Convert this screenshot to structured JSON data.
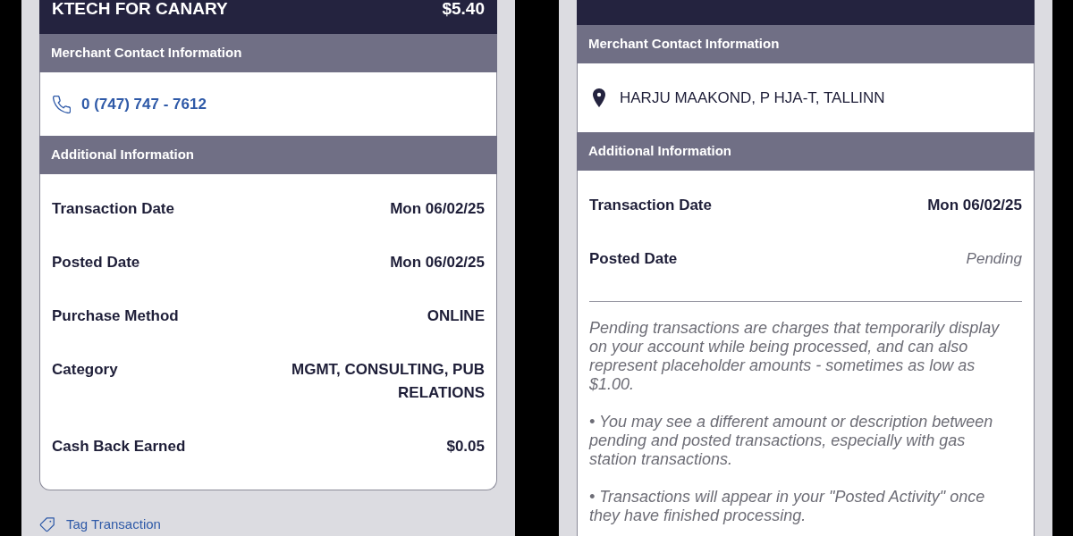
{
  "panels": [
    {
      "header": {
        "merchant": "KTECH FOR CANARY",
        "amount": "$5.40"
      },
      "sections": [
        {
          "title": "Merchant Contact Information",
          "contact": {
            "kind": "phone",
            "text": "0 (747) 747 - 7612"
          }
        },
        {
          "title": "Additional Information",
          "rows": [
            {
              "label": "Transaction Date",
              "value": "Mon 06/02/25"
            },
            {
              "label": "Posted Date",
              "value": "Mon 06/02/25"
            },
            {
              "label": "Purchase Method",
              "value": "ONLINE"
            },
            {
              "label": "Category",
              "value": "MGMT, CONSULTING, PUB RELATIONS"
            },
            {
              "label": "Cash Back Earned",
              "value": "$0.05"
            }
          ]
        }
      ],
      "tag_link": "Tag Transaction"
    },
    {
      "sections": [
        {
          "title": "Merchant Contact Information",
          "contact": {
            "kind": "address",
            "text": "HARJU MAAKOND, P HJA-T, TALLINN"
          }
        },
        {
          "title": "Additional Information",
          "rows": [
            {
              "label": "Transaction Date",
              "value": "Mon 06/02/25",
              "kind": "plain"
            },
            {
              "label": "Posted Date",
              "value": "Pending",
              "kind": "pending"
            }
          ],
          "notes": [
            "Pending transactions are charges that temporarily display on your account while being processed, and can also represent placeholder amounts - sometimes as low as $1.00.",
            "• You may see a different amount or description between pending and posted transactions, especially with gas station transactions.",
            "• Transactions will appear in your \"Posted Activity\" once they have finished processing."
          ]
        }
      ]
    }
  ]
}
